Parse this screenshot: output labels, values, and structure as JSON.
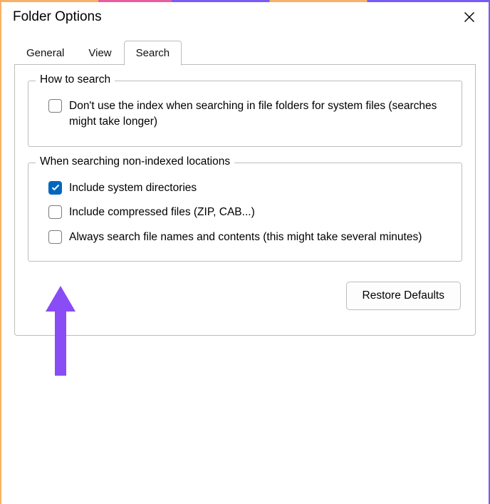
{
  "window": {
    "title": "Folder Options"
  },
  "tabs": {
    "general": "General",
    "view": "View",
    "search": "Search",
    "active": "search"
  },
  "groups": {
    "how": {
      "legend": "How to search",
      "options": [
        {
          "label": "Don't use the index when searching in file folders for system files (searches might take longer)",
          "checked": false
        }
      ]
    },
    "nonindexed": {
      "legend": "When searching non-indexed locations",
      "options": [
        {
          "label": "Include system directories",
          "checked": true
        },
        {
          "label": "Include compressed files (ZIP, CAB...)",
          "checked": false
        },
        {
          "label": "Always search file names and contents (this might take several minutes)",
          "checked": false
        }
      ]
    }
  },
  "buttons": {
    "restore": "Restore Defaults"
  }
}
